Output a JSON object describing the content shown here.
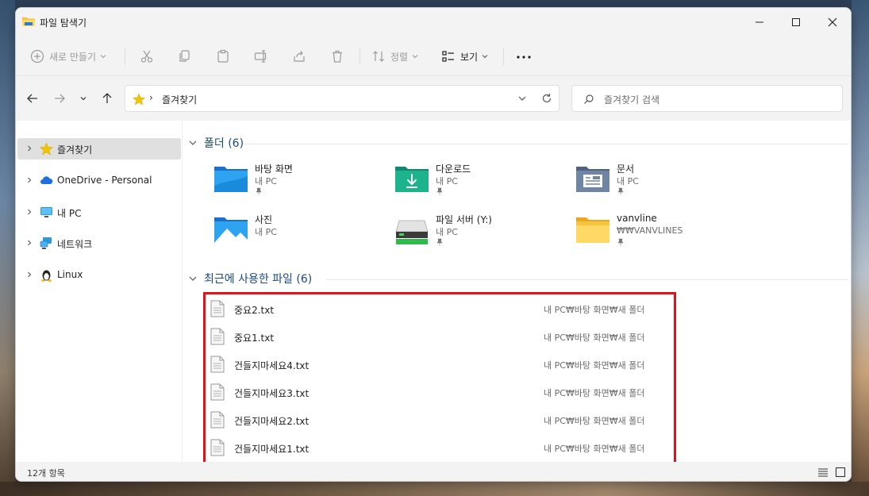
{
  "window": {
    "title": "파일 탐색기"
  },
  "toolbar": {
    "new_label": "새로 만들기",
    "sort_label": "정렬",
    "view_label": "보기",
    "more_label": "..."
  },
  "address": {
    "chevron": "›",
    "path": "즐겨찾기"
  },
  "search": {
    "placeholder": "즐겨찾기 검색"
  },
  "sidebar": {
    "items": [
      {
        "label": "즐겨찾기",
        "icon": "star-icon"
      },
      {
        "label": "OneDrive - Personal",
        "icon": "cloud-icon"
      },
      {
        "label": "내 PC",
        "icon": "monitor-icon"
      },
      {
        "label": "네트워크",
        "icon": "network-icon"
      },
      {
        "label": "Linux",
        "icon": "linux-icon"
      }
    ]
  },
  "folders_section": {
    "title": "폴더 (6)",
    "items": [
      {
        "name": "바탕 화면",
        "sub": "내 PC",
        "icon": "desktop-folder-icon"
      },
      {
        "name": "다운로드",
        "sub": "내 PC",
        "icon": "downloads-folder-icon"
      },
      {
        "name": "문서",
        "sub": "내 PC",
        "icon": "documents-folder-icon"
      },
      {
        "name": "사진",
        "sub": "내 PC",
        "icon": "pictures-folder-icon"
      },
      {
        "name": "파일 서버 (Y:)",
        "sub": "내 PC",
        "icon": "network-drive-icon"
      },
      {
        "name": "vanvline",
        "sub": "₩₩VANVLINES",
        "icon": "folder-icon"
      }
    ]
  },
  "recent_section": {
    "title": "최근에 사용한 파일 (6)",
    "files": [
      {
        "name": "중요2.txt",
        "path": "내 PC₩바탕 화면₩새 폴더"
      },
      {
        "name": "중요1.txt",
        "path": "내 PC₩바탕 화면₩새 폴더"
      },
      {
        "name": "건들지마세요4.txt",
        "path": "내 PC₩바탕 화면₩새 폴더"
      },
      {
        "name": "건들지마세요3.txt",
        "path": "내 PC₩바탕 화면₩새 폴더"
      },
      {
        "name": "건들지마세요2.txt",
        "path": "내 PC₩바탕 화면₩새 폴더"
      },
      {
        "name": "건들지마세요1.txt",
        "path": "내 PC₩바탕 화면₩새 폴더"
      }
    ]
  },
  "status": {
    "item_count": "12개 항목"
  },
  "colors": {
    "accent": "#1a4a82",
    "highlight_border": "#e0121b",
    "folder_yellow": "#f5c542",
    "star": "#f3c400"
  }
}
